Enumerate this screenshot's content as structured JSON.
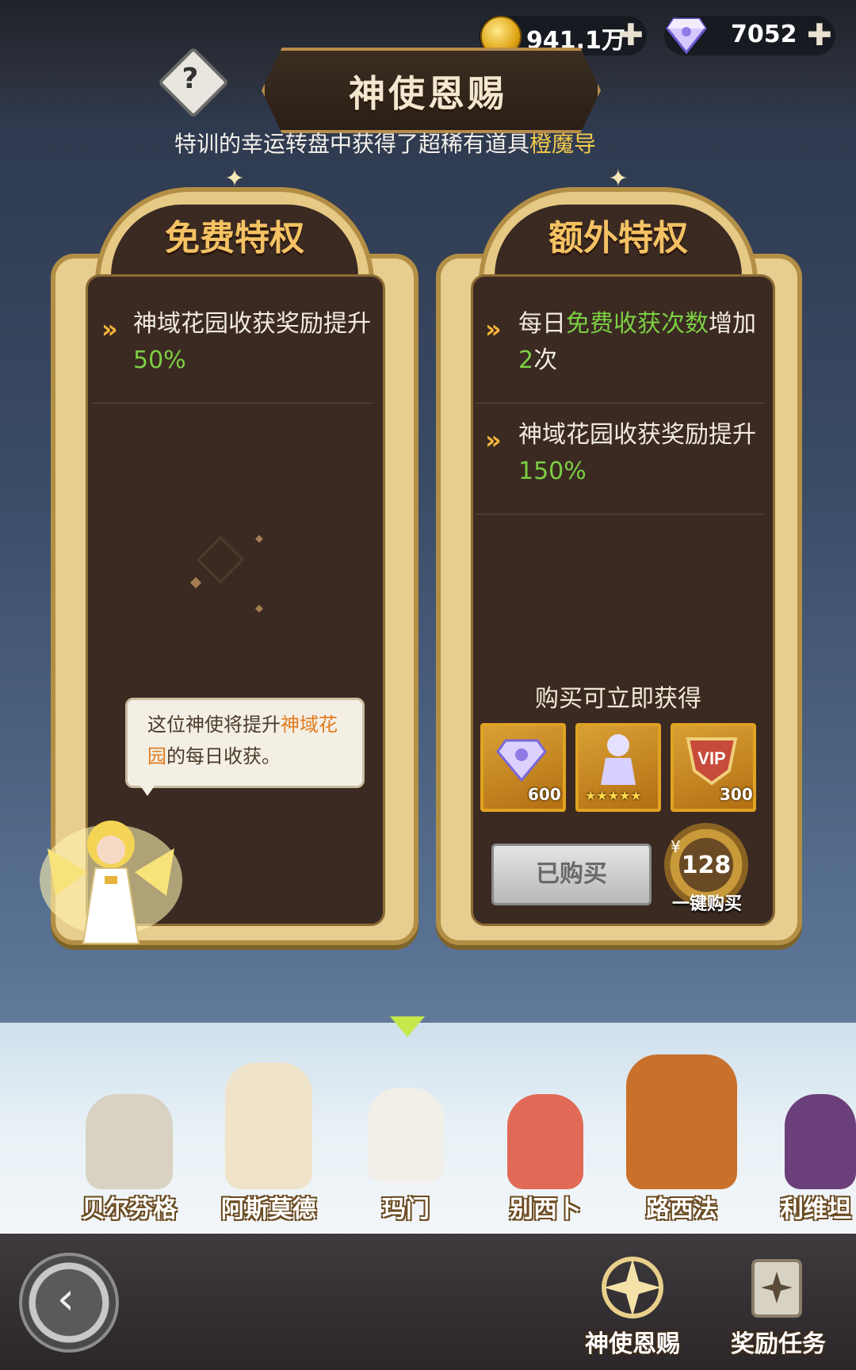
{
  "topbar": {
    "gold_value": "941.1万",
    "diamond_value": "7052",
    "plus": "✚"
  },
  "header": {
    "title": "神使恩赐",
    "help_symbol": "?"
  },
  "ticker": {
    "text_prefix": "特训的幸运转盘中获得了超稀有道具",
    "text_highlight": "橙魔导"
  },
  "free_panel": {
    "title": "免费特权",
    "items": [
      {
        "pre": "神域花园收获奖励提升",
        "green": "50%",
        "post": ""
      }
    ]
  },
  "extra_panel": {
    "title": "额外特权",
    "items": [
      {
        "pre": "每日",
        "green": "免费收获次数",
        "mid": "增加",
        "green2": "2",
        "post": "次"
      },
      {
        "pre": "神域花园收获奖励提升",
        "green": "150%",
        "post": ""
      }
    ],
    "purchase_header": "购买可立即获得",
    "rewards": [
      {
        "icon": "diamond-icon",
        "qty": "600"
      },
      {
        "icon": "hero-card-icon",
        "qty": "★★★★★"
      },
      {
        "icon": "vip-icon",
        "qty": "300"
      }
    ],
    "bought_label": "已购买",
    "currency_symbol": "¥",
    "price": "128",
    "one_click_label": "一键购买"
  },
  "speech": {
    "pre": "这位神使将提升",
    "highlight": "神域花园",
    "post": "的每日收获。"
  },
  "characters": [
    {
      "name": "贝尔芬格",
      "color": "#d9d2c2"
    },
    {
      "name": "阿斯莫德",
      "color": "#efe3c9"
    },
    {
      "name": "玛门",
      "color": "#f2efe9"
    },
    {
      "name": "别西卜",
      "color": "#e06a56"
    },
    {
      "name": "路西法",
      "color": "#c9702a"
    },
    {
      "name": "利维坦",
      "color": "#6b3f7a"
    }
  ],
  "bottom_nav": {
    "tab_1": "神使恩赐",
    "tab_2": "奖励任务"
  },
  "colors": {
    "gold": "#e0a515",
    "panel_frame": "#e7cd8f",
    "highlight_green": "#7ccf43",
    "highlight_orange": "#e07c1f"
  }
}
